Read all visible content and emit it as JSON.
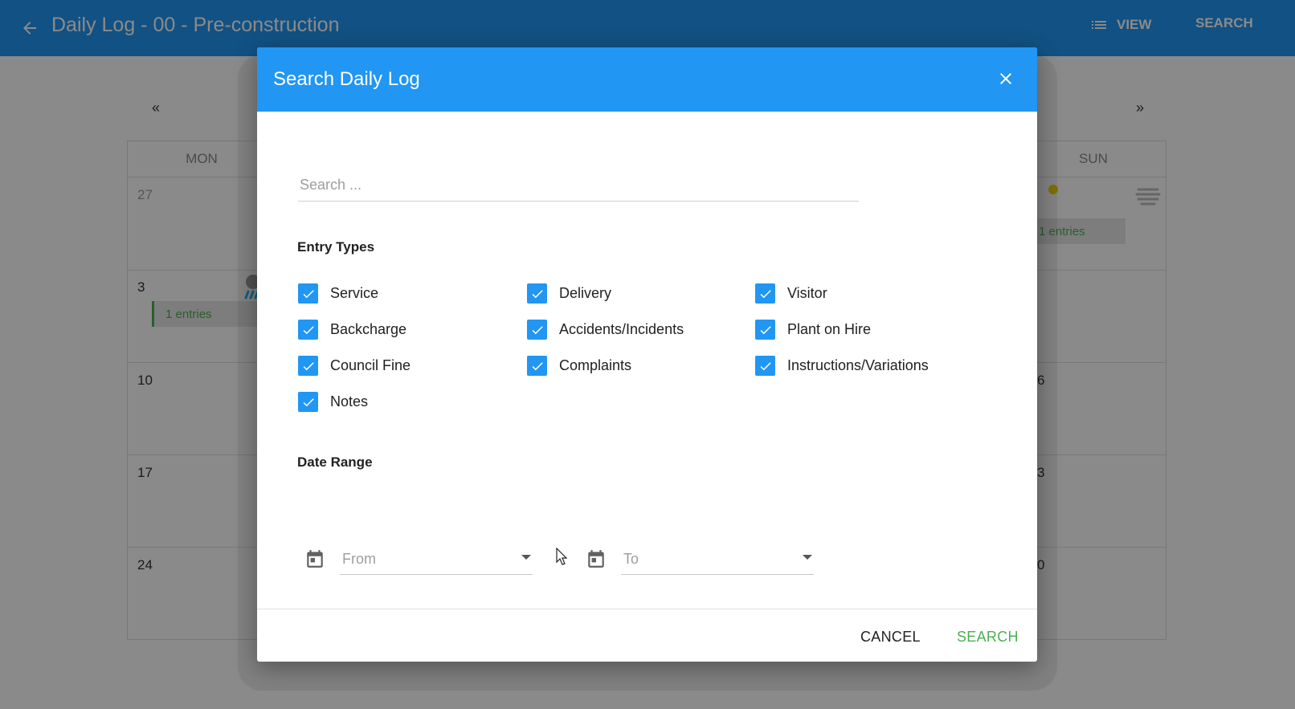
{
  "appbar": {
    "title": "Daily Log - 00 - Pre-construction",
    "view_label": "VIEW",
    "search_label": "SEARCH",
    "back_icon": "arrow-left-icon",
    "view_icon": "list-icon"
  },
  "calendar": {
    "prev": "«",
    "next": "»",
    "headers": {
      "mon": "MON",
      "sun": "SUN"
    },
    "rows": [
      {
        "mon": "27",
        "sun": ""
      },
      {
        "mon": "3",
        "sun": ""
      },
      {
        "mon": "10",
        "sun": "6"
      },
      {
        "mon": "17",
        "sun": "3"
      },
      {
        "mon": "24",
        "sun": "0"
      }
    ],
    "entries_label": "1 entries"
  },
  "dialog": {
    "title": "Search Daily Log",
    "search_placeholder": "Search ...",
    "entry_types_label": "Entry Types",
    "entry_types": [
      {
        "label": "Service",
        "checked": true
      },
      {
        "label": "Delivery",
        "checked": true
      },
      {
        "label": "Visitor",
        "checked": true
      },
      {
        "label": "Backcharge",
        "checked": true
      },
      {
        "label": "Accidents/Incidents",
        "checked": true
      },
      {
        "label": "Plant on Hire",
        "checked": true
      },
      {
        "label": "Council Fine",
        "checked": true
      },
      {
        "label": "Complaints",
        "checked": true
      },
      {
        "label": "Instructions/Variations",
        "checked": true
      },
      {
        "label": "Notes",
        "checked": true
      }
    ],
    "date_range_label": "Date Range",
    "from_placeholder": "From",
    "to_placeholder": "To",
    "cancel_label": "CANCEL",
    "search_label": "SEARCH"
  },
  "colors": {
    "primary": "#2196f3",
    "accent_green": "#4caf50"
  }
}
